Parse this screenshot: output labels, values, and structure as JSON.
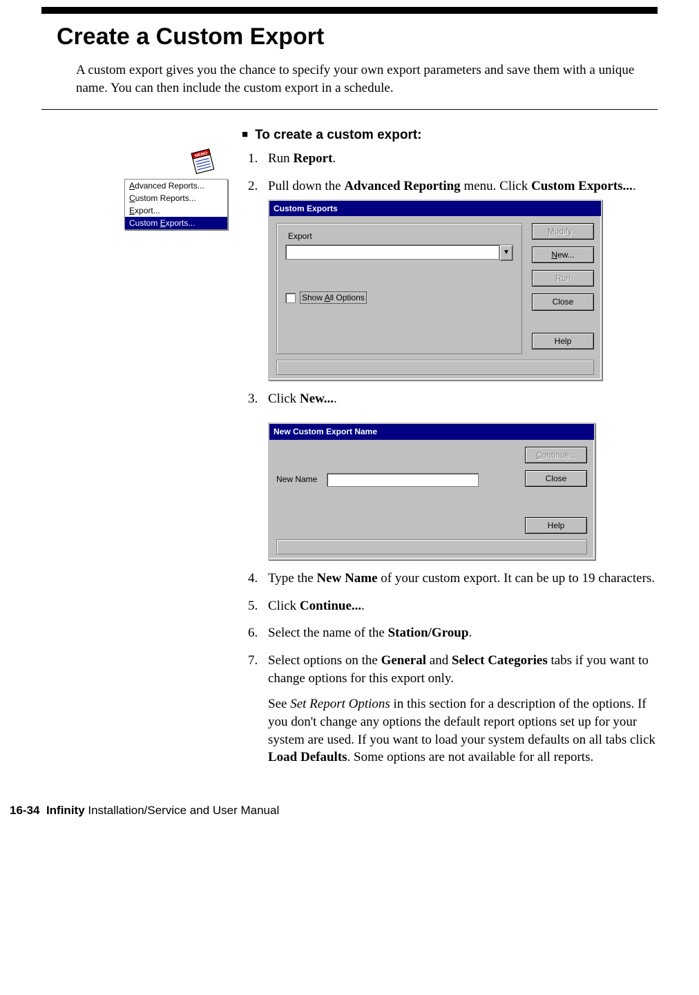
{
  "page": {
    "title": "Create a Custom Export",
    "intro": "A custom export gives you the chance to specify your own export parameters and save them with a unique name. You can then include the custom export in a schedule.",
    "procedure_heading": "To create a custom export:"
  },
  "menu": {
    "items": [
      "Advanced Reports...",
      "Custom Reports...",
      "Export...",
      "Custom Exports..."
    ],
    "underline_index": [
      0,
      0,
      0,
      7
    ],
    "selected_index": 3
  },
  "steps": {
    "s1_pre": "Run ",
    "s1_b": "Report",
    "s1_post": ".",
    "s2_pre": "Pull down the ",
    "s2_b1": "Advanced Reporting",
    "s2_mid": " menu. Click ",
    "s2_b2": "Custom Exports...",
    "s2_post": ".",
    "s3_pre": "Click ",
    "s3_b": "New...",
    "s3_post": ".",
    "s4_pre": "Type the ",
    "s4_b": "New Name",
    "s4_post": " of your custom export. It can be up to 19 characters.",
    "s5_pre": "Click ",
    "s5_b": "Continue...",
    "s5_post": ".",
    "s6_pre": "Select the name of the ",
    "s6_b": "Station/Group",
    "s6_post": ".",
    "s7_pre": "Select options on the ",
    "s7_b1": "General",
    "s7_mid": " and ",
    "s7_b2": "Select Categories",
    "s7_post": " tabs if you want to change options for this export only.",
    "s7p_pre": "See ",
    "s7p_i": "Set Report Options",
    "s7p_mid": " in this section for a description of the options. If you don't change any options the default report options set up for your system are used. If you want to load your system defaults on all tabs click ",
    "s7p_b": "Load Defaults",
    "s7p_post": ". Some options are not available for all reports."
  },
  "dialog1": {
    "title": "Custom Exports",
    "export_label": "Export",
    "show_all": "Show All Options",
    "buttons": {
      "modify": "Modify...",
      "new": "New...",
      "run": "Run",
      "close": "Close",
      "help": "Help"
    }
  },
  "dialog2": {
    "title": "New Custom Export Name",
    "new_name_label": "New Name",
    "buttons": {
      "continue": "Continue...",
      "close": "Close",
      "help": "Help"
    }
  },
  "footer": {
    "page_ref": "16-34",
    "product": "Infinity",
    "rest": " Installation/Service and User Manual"
  }
}
